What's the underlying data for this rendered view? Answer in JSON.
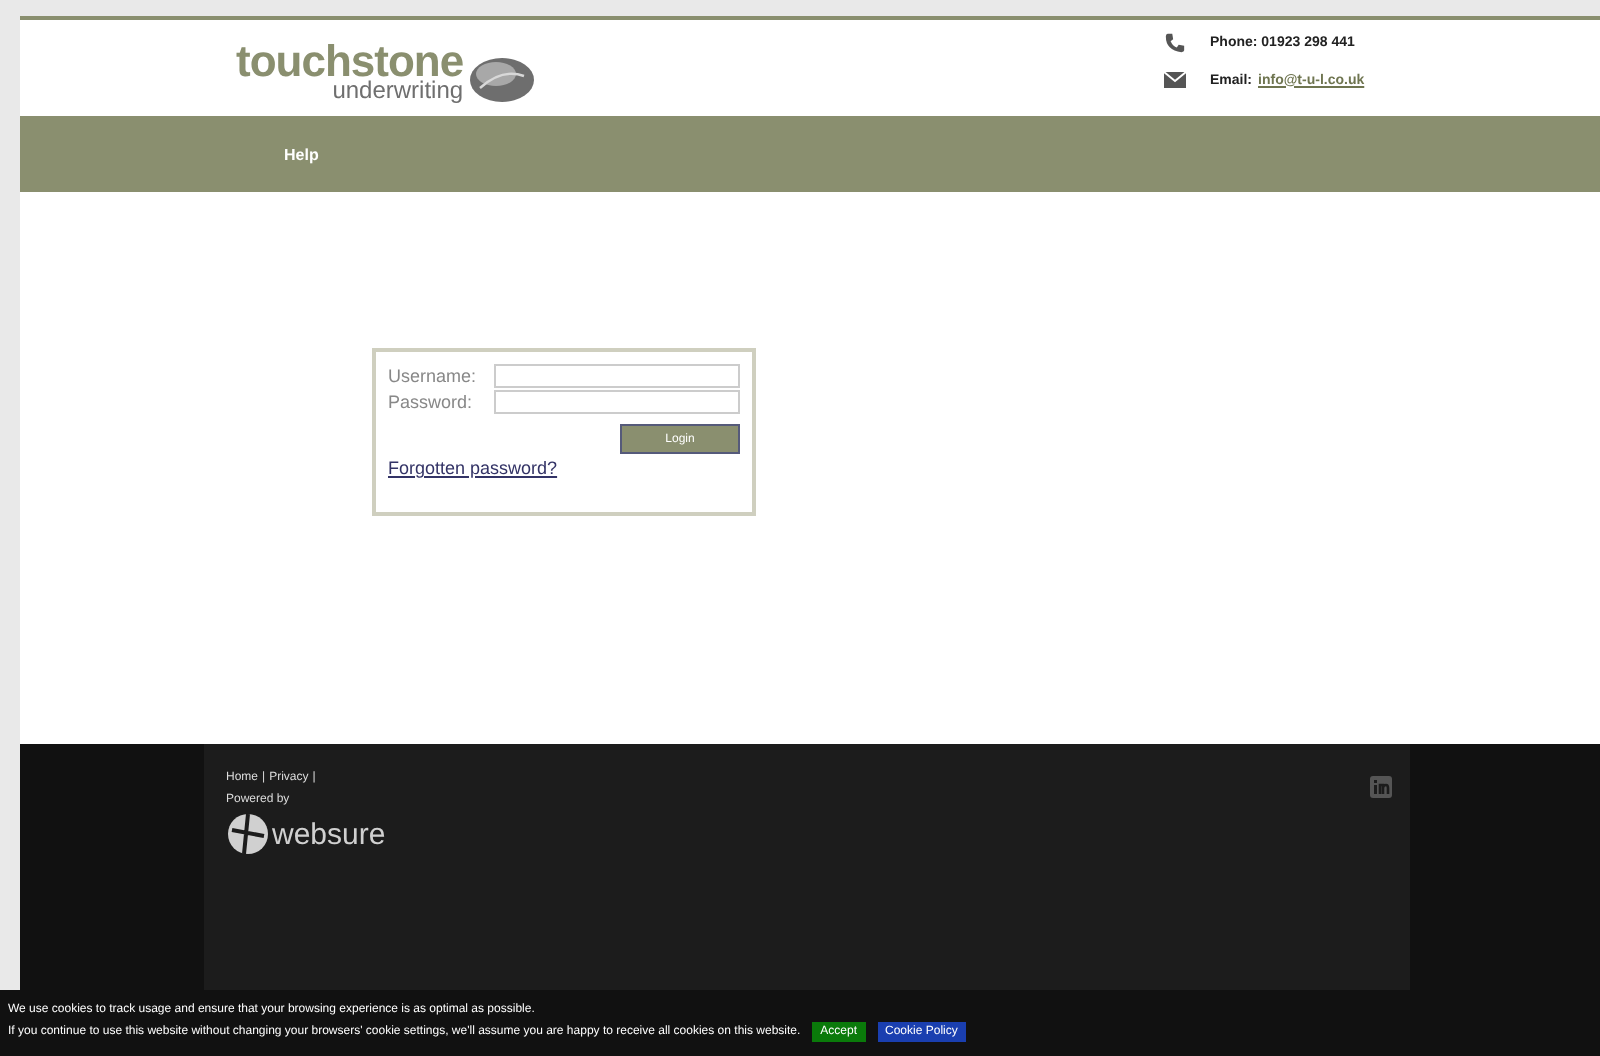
{
  "header": {
    "logo_main": "touchstone",
    "logo_sub": "underwriting",
    "phone": "Phone: 01923 298 441",
    "email_label": "Email:",
    "email": "info@t-u-l.co.uk"
  },
  "nav": [
    "Help"
  ],
  "login": {
    "username_label": "Username:",
    "password_label": "Password:",
    "button": "Login",
    "forgot": "Forgotten password?"
  },
  "footer": {
    "links": [
      {
        "label": "Home",
        "separator": "|"
      },
      {
        "label": "Privacy",
        "separator": "|"
      }
    ],
    "powered_by": "Powered by",
    "brand": "websure"
  },
  "cookie_bar": {
    "line1": "We use cookies to track usage and ensure that your browsing experience is as optimal as possible.",
    "line2": "If you continue to use this website without changing your browsers' cookie settings, we'll assume you are happy to receive all cookies on this website.",
    "accept": "Accept",
    "policy": "Cookie Policy"
  }
}
